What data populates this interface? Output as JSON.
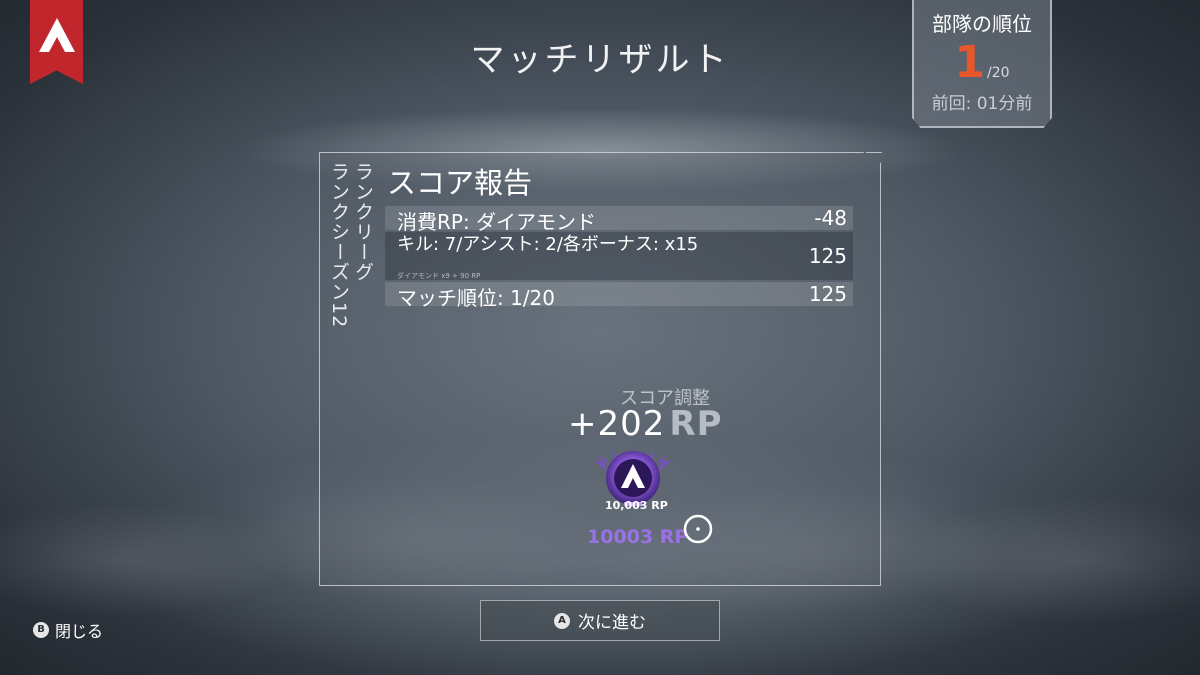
{
  "header": {
    "title": "マッチリザルト"
  },
  "placement": {
    "title": "部隊の順位",
    "rank": "1",
    "total": "/20",
    "previous": "前回: 01分前"
  },
  "score_panel": {
    "season_label": "ランクリーグ\nランクシーズン12",
    "title": "スコア報告",
    "rows": [
      {
        "label": "消費RP: ダイアモンド",
        "value": "-48"
      },
      {
        "label": "キル: 7/アシスト: 2/各ボーナス: x15",
        "value": "125",
        "sub": "ダイアモンド x9 + 90 RP"
      },
      {
        "label": "マッチ順位: 1/20",
        "value": "125"
      }
    ],
    "adjustment_label": "スコア調整",
    "adjustment_value": "+202",
    "adjustment_unit": "RP",
    "badge_rp": "10,003 RP",
    "total_rp": "10003 RP"
  },
  "controls": {
    "close_glyph": "B",
    "close_label": "閉じる",
    "next_glyph": "A",
    "next_label": "次に進む"
  },
  "colors": {
    "logo_red": "#c0262b",
    "rank_orange": "#e8562a",
    "master_purple": "#9b72e6"
  },
  "icons": {
    "logo": "apex-logo-icon",
    "badge": "master-rank-badge-icon",
    "loading": "loading-ring-icon"
  }
}
